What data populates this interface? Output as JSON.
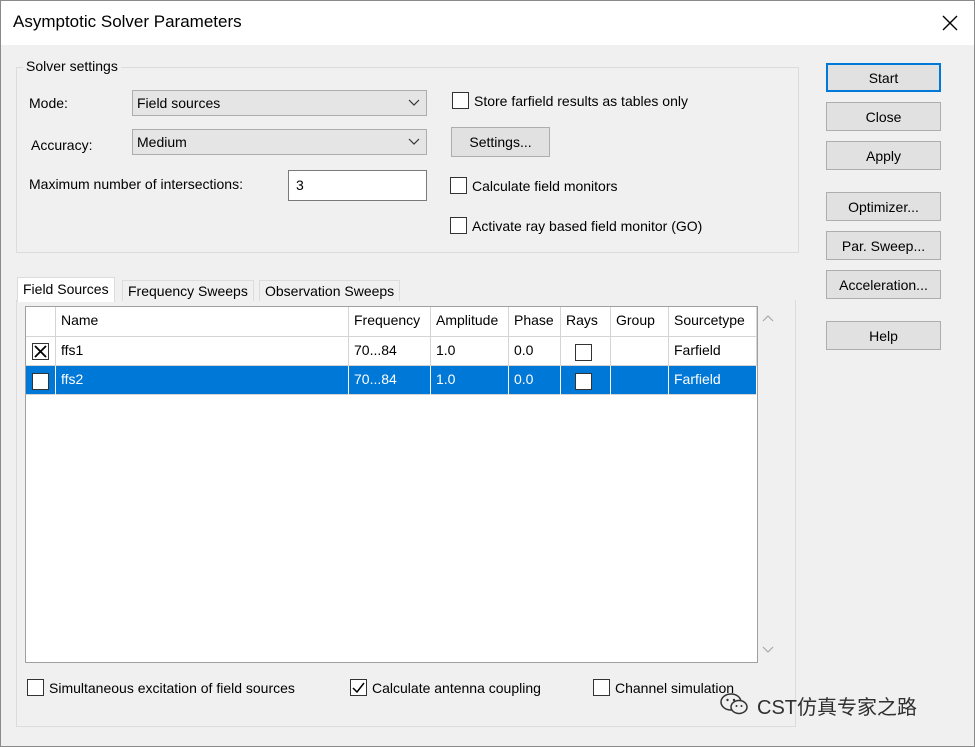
{
  "window": {
    "title": "Asymptotic Solver Parameters"
  },
  "solver_settings": {
    "group_label": "Solver settings",
    "mode_label": "Mode:",
    "mode_value": "Field sources",
    "accuracy_label": "Accuracy:",
    "accuracy_value": "Medium",
    "max_intersections_label": "Maximum number of intersections:",
    "max_intersections_value": "3",
    "store_farfield_label": "Store farfield results as tables only",
    "store_farfield_checked": false,
    "settings_button": "Settings...",
    "calc_field_monitors_label": "Calculate field monitors",
    "calc_field_monitors_checked": false,
    "activate_ray_label": "Activate ray based field monitor (GO)",
    "activate_ray_checked": false
  },
  "buttons": {
    "start": "Start",
    "close": "Close",
    "apply": "Apply",
    "optimizer": "Optimizer...",
    "par_sweep": "Par. Sweep...",
    "acceleration": "Acceleration...",
    "help": "Help"
  },
  "tabs": [
    {
      "label": "Field Sources",
      "active": true
    },
    {
      "label": "Frequency Sweeps",
      "active": false
    },
    {
      "label": "Observation Sweeps",
      "active": false
    }
  ],
  "table": {
    "columns": [
      "",
      "Name",
      "Frequency",
      "Amplitude",
      "Phase",
      "Rays",
      "Group",
      "Sourcetype"
    ],
    "rows": [
      {
        "enabled": true,
        "name": "ffs1",
        "frequency": "70...84",
        "amplitude": "1.0",
        "phase": "0.0",
        "rays": false,
        "group": "",
        "sourcetype": "Farfield",
        "selected": false
      },
      {
        "enabled": false,
        "name": "ffs2",
        "frequency": "70...84",
        "amplitude": "1.0",
        "phase": "0.0",
        "rays": false,
        "group": "",
        "sourcetype": "Farfield",
        "selected": true
      }
    ]
  },
  "bottom_options": {
    "simultaneous_label": "Simultaneous excitation of field sources",
    "simultaneous_checked": false,
    "antenna_coupling_label": "Calculate antenna coupling",
    "antenna_coupling_checked": true,
    "channel_sim_label": "Channel simulation",
    "channel_sim_checked": false
  },
  "watermark": {
    "text": "CST仿真专家之路"
  },
  "colors": {
    "selection": "#0078d7",
    "dialog_bg": "#f0f0f0",
    "default_button_border": "#0078d7"
  }
}
